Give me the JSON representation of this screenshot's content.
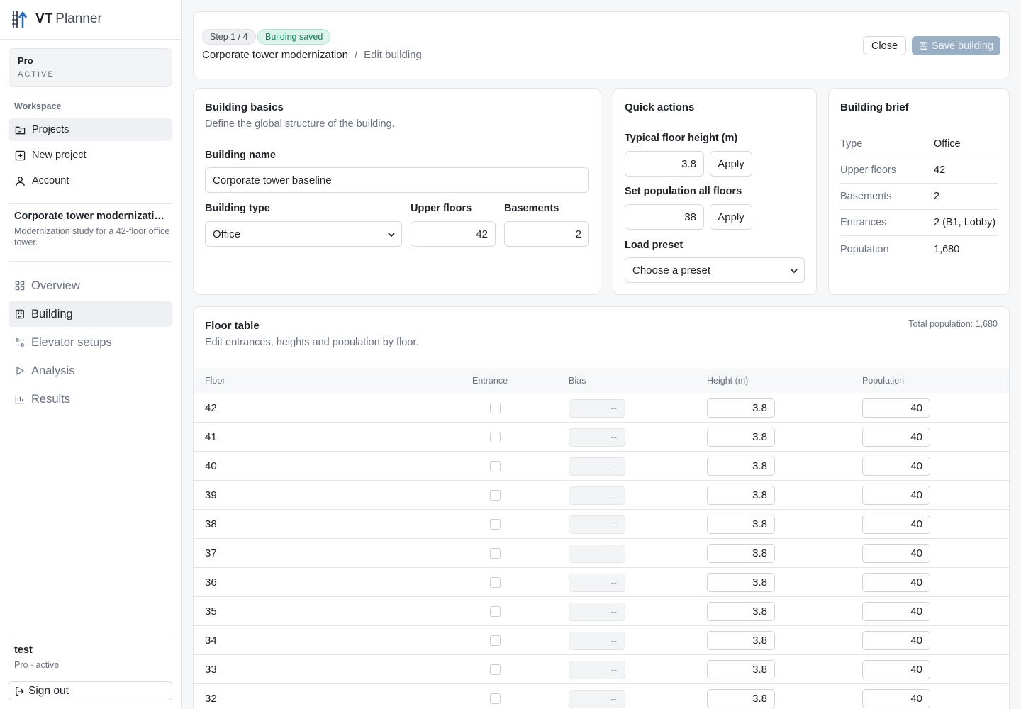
{
  "brand": {
    "vt": "VT",
    "planner": "Planner"
  },
  "plan": {
    "name": "Pro",
    "status": "ACTIVE"
  },
  "workspace": {
    "label": "Workspace",
    "items": [
      {
        "label": "Projects",
        "icon": "folder-icon"
      },
      {
        "label": "New project",
        "icon": "plus-square-icon"
      },
      {
        "label": "Account",
        "icon": "user-icon"
      }
    ]
  },
  "project": {
    "title": "Corporate tower modernizati…",
    "description": "Modernization study for a 42-floor office tower."
  },
  "project_nav": [
    {
      "label": "Overview",
      "icon": "grid-icon"
    },
    {
      "label": "Building",
      "icon": "building-icon"
    },
    {
      "label": "Elevator setups",
      "icon": "sliders-icon"
    },
    {
      "label": "Analysis",
      "icon": "play-icon"
    },
    {
      "label": "Results",
      "icon": "bar-chart-icon"
    }
  ],
  "user": {
    "name": "test",
    "status": "Pro · active",
    "signout": "Sign out"
  },
  "header": {
    "step": "Step 1 / 4",
    "badge": "Building saved",
    "project": "Corporate tower modernization",
    "separator": "/",
    "page": "Edit building",
    "close": "Close",
    "save": "Save building"
  },
  "basics": {
    "title": "Building basics",
    "subtitle": "Define the global structure of the building.",
    "name_label": "Building name",
    "name_value": "Corporate tower baseline",
    "type_label": "Building type",
    "type_value": "Office",
    "upper_label": "Upper floors",
    "upper_value": "42",
    "basements_label": "Basements",
    "basements_value": "2"
  },
  "quick": {
    "title": "Quick actions",
    "height_label": "Typical floor height (m)",
    "height_value": "3.8",
    "pop_label": "Set population all floors",
    "pop_value": "38",
    "apply": "Apply",
    "preset_label": "Load preset",
    "preset_value": "Choose a preset"
  },
  "brief": {
    "title": "Building brief",
    "rows": [
      {
        "k": "Type",
        "v": "Office"
      },
      {
        "k": "Upper floors",
        "v": "42"
      },
      {
        "k": "Basements",
        "v": "2"
      },
      {
        "k": "Entrances",
        "v": "2 (B1, Lobby)"
      },
      {
        "k": "Population",
        "v": "1,680"
      }
    ]
  },
  "floor_table": {
    "title": "Floor table",
    "subtitle": "Edit entrances, heights and population by floor.",
    "total": "Total population: 1,680",
    "columns": [
      "Floor",
      "Entrance",
      "Bias",
      "Height (m)",
      "Population"
    ],
    "rows": [
      {
        "floor": "42",
        "entrance": false,
        "bias": "--",
        "height": "3.8",
        "population": "40"
      },
      {
        "floor": "41",
        "entrance": false,
        "bias": "--",
        "height": "3.8",
        "population": "40"
      },
      {
        "floor": "40",
        "entrance": false,
        "bias": "--",
        "height": "3.8",
        "population": "40"
      },
      {
        "floor": "39",
        "entrance": false,
        "bias": "--",
        "height": "3.8",
        "population": "40"
      },
      {
        "floor": "38",
        "entrance": false,
        "bias": "--",
        "height": "3.8",
        "population": "40"
      },
      {
        "floor": "37",
        "entrance": false,
        "bias": "--",
        "height": "3.8",
        "population": "40"
      },
      {
        "floor": "36",
        "entrance": false,
        "bias": "--",
        "height": "3.8",
        "population": "40"
      },
      {
        "floor": "35",
        "entrance": false,
        "bias": "--",
        "height": "3.8",
        "population": "40"
      },
      {
        "floor": "34",
        "entrance": false,
        "bias": "--",
        "height": "3.8",
        "population": "40"
      },
      {
        "floor": "33",
        "entrance": false,
        "bias": "--",
        "height": "3.8",
        "population": "40"
      },
      {
        "floor": "32",
        "entrance": false,
        "bias": "--",
        "height": "3.8",
        "population": "40"
      }
    ]
  }
}
